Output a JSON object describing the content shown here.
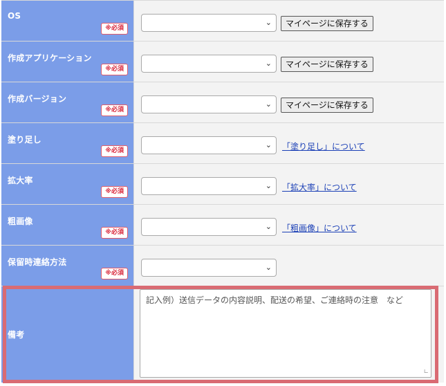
{
  "required_label": "※必須",
  "save_label": "マイページに保存する",
  "colors": {
    "label_bg": "#7b9de8",
    "required": "#d9263a",
    "highlight": "#d96b73",
    "link": "#1a3fb6"
  },
  "rows": [
    {
      "label": "OS",
      "required": true,
      "select_value": "",
      "save_button": true
    },
    {
      "label": "作成アプリケーション",
      "required": true,
      "select_value": "",
      "save_button": true
    },
    {
      "label": "作成バージョン",
      "required": true,
      "select_value": "",
      "save_button": true
    },
    {
      "label": "塗り足し",
      "required": true,
      "select_value": "",
      "link": "「塗り足し」について"
    },
    {
      "label": "拡大率",
      "required": true,
      "select_value": "",
      "link": "「拡大率」について"
    },
    {
      "label": "粗画像",
      "required": true,
      "select_value": "",
      "link": "「粗画像」について"
    },
    {
      "label": "保留時連絡方法",
      "required": true,
      "select_value": ""
    }
  ],
  "notes": {
    "label": "備考",
    "value": "",
    "placeholder": "記入例）送信データの内容説明、配送の希望、ご連絡時の注意　など"
  }
}
